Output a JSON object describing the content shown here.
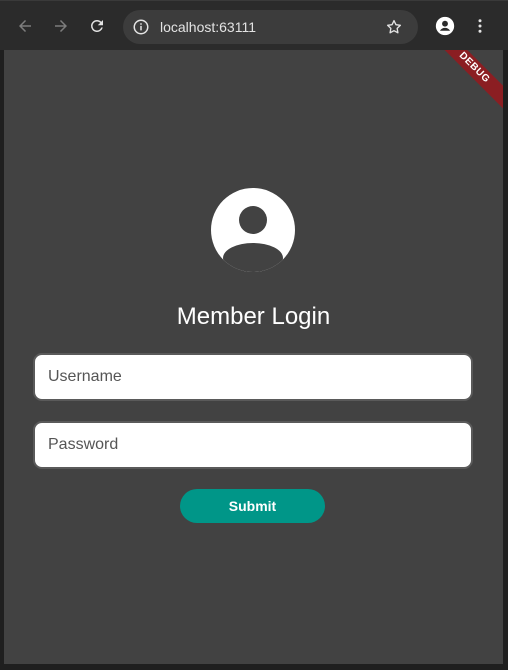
{
  "browser": {
    "url": "localhost:63111",
    "icons": {
      "back": "arrow-left-icon",
      "forward": "arrow-right-icon",
      "reload": "reload-icon",
      "info": "info-icon",
      "bookmark": "star-icon",
      "profile": "profile-icon",
      "menu": "kebab-menu-icon"
    }
  },
  "app": {
    "debug_banner": "DEBUG",
    "avatar_icon": "account-circle-icon",
    "title": "Member Login",
    "username": {
      "placeholder": "Username",
      "value": ""
    },
    "password": {
      "placeholder": "Password",
      "value": ""
    },
    "submit_label": "Submit",
    "colors": {
      "background": "#424242",
      "accent": "#009688",
      "debug": "#8b1e22"
    }
  }
}
